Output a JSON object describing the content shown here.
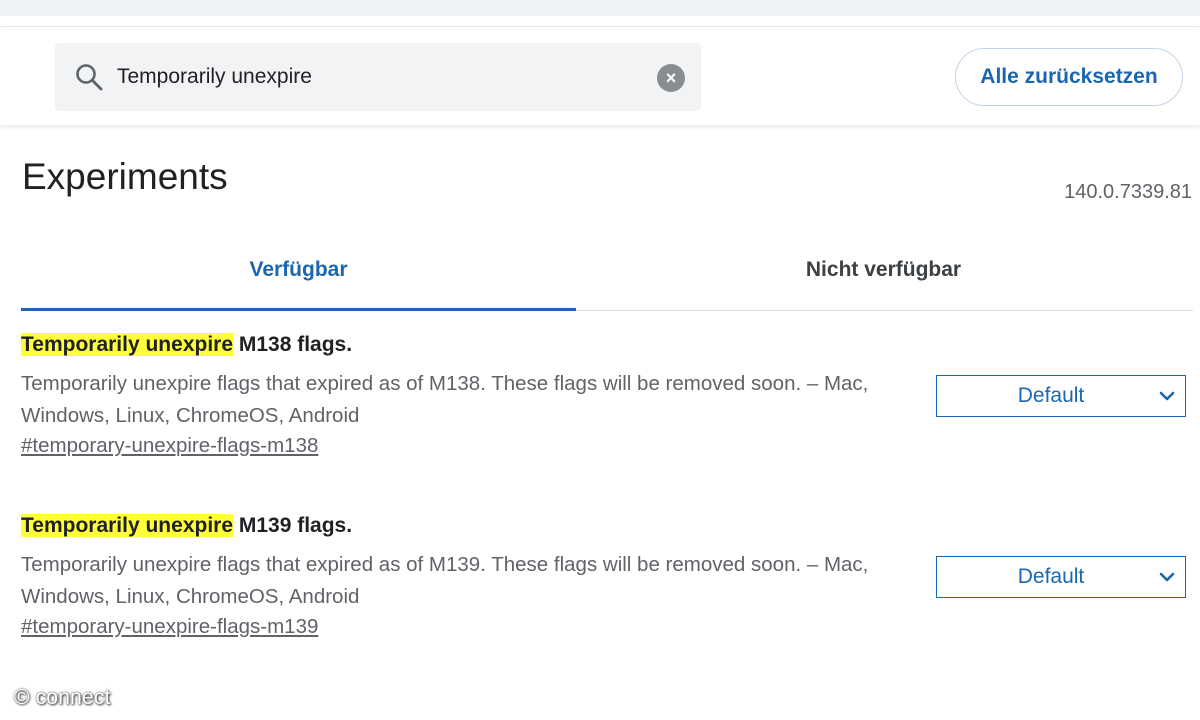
{
  "search": {
    "value": "Temporarily unexpire",
    "search_icon": "search-icon",
    "clear_icon": "clear-icon",
    "clear_symbol": "×"
  },
  "header": {
    "reset_label": "Alle zurücksetzen"
  },
  "page": {
    "title": "Experiments",
    "version": "140.0.7339.81"
  },
  "tabs": [
    {
      "label": "Verfügbar",
      "active": true
    },
    {
      "label": "Nicht verfügbar",
      "active": false
    }
  ],
  "flags": [
    {
      "title_highlight": "Temporarily unexpire",
      "title_rest": " M138 flags.",
      "description": "Temporarily unexpire flags that expired as of M138. These flags will be removed soon. – Mac, Windows, Linux, ChromeOS, Android",
      "link": "#temporary-unexpire-flags-m138",
      "select_value": "Default"
    },
    {
      "title_highlight": "Temporarily unexpire",
      "title_rest": " M139 flags.",
      "description": "Temporarily unexpire flags that expired as of M139. These flags will be removed soon. – Mac, Windows, Linux, ChromeOS, Android",
      "link": "#temporary-unexpire-flags-m139",
      "select_value": "Default"
    }
  ],
  "watermark": "© connect",
  "colors": {
    "accent": "#1a66b0",
    "highlight": "#ffff3a",
    "muted_text": "#5f6368"
  }
}
